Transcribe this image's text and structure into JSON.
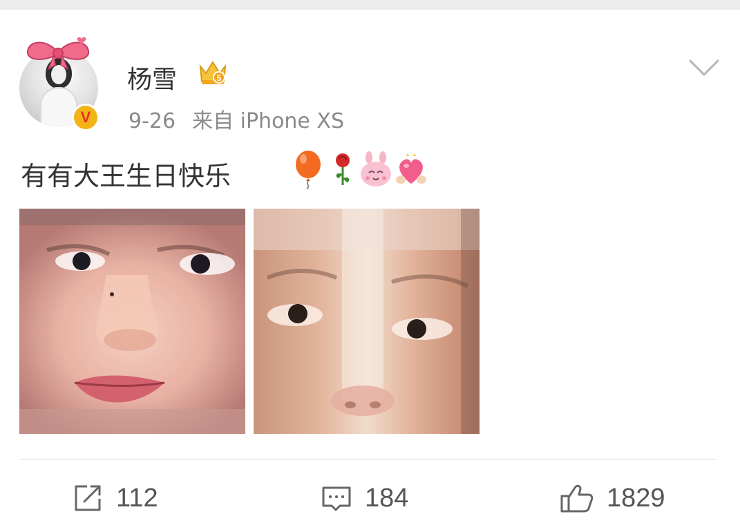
{
  "user": {
    "name": "杨雪",
    "verified_badge": "V",
    "crown_badge_icon": "svip-crown-icon"
  },
  "meta": {
    "date": "9-26",
    "source": "来自 iPhone XS"
  },
  "post": {
    "text": "有有大王生日快乐",
    "emojis": [
      "balloon-icon",
      "rose-icon",
      "pink-bunny-icon",
      "heart-hands-icon"
    ],
    "photos": [
      {
        "description_icon": "face-photo-1"
      },
      {
        "description_icon": "face-photo-2"
      }
    ]
  },
  "actions": {
    "repost_count": "112",
    "comment_count": "184",
    "like_count": "1829"
  },
  "colors": {
    "verified": "#f3b418",
    "badge_text": "#e4321c",
    "text": "#333333",
    "muted": "#8a8a8a"
  }
}
